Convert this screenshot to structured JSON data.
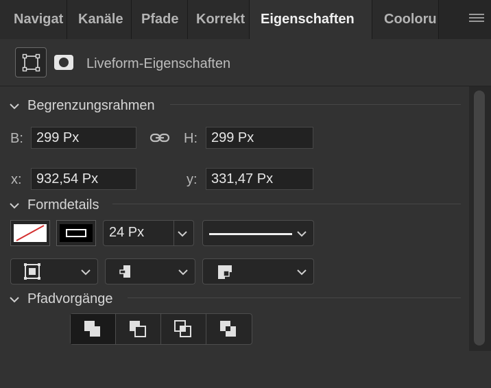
{
  "tabs": [
    {
      "label": "Navigat"
    },
    {
      "label": "Kanäle"
    },
    {
      "label": "Pfade"
    },
    {
      "label": "Korrekt"
    },
    {
      "label": "Eigenschaften"
    },
    {
      "label": "Cooloru"
    }
  ],
  "header": {
    "title": "Liveform-Eigenschaften"
  },
  "bounding_box": {
    "section_title": "Begrenzungsrahmen",
    "w_label": "B:",
    "w_value": "299 Px",
    "h_label": "H:",
    "h_value": "299 Px",
    "x_label": "x:",
    "x_value": "932,54 Px",
    "y_label": "y:",
    "y_value": "331,47 Px"
  },
  "shape_details": {
    "section_title": "Formdetails",
    "stroke_width": "24 Px"
  },
  "path_ops": {
    "section_title": "Pfadvorgänge"
  },
  "colors": {
    "panel_bg": "#323232",
    "tab_bg": "#262626",
    "stroke_fill_none_red": "#d32f2f"
  }
}
